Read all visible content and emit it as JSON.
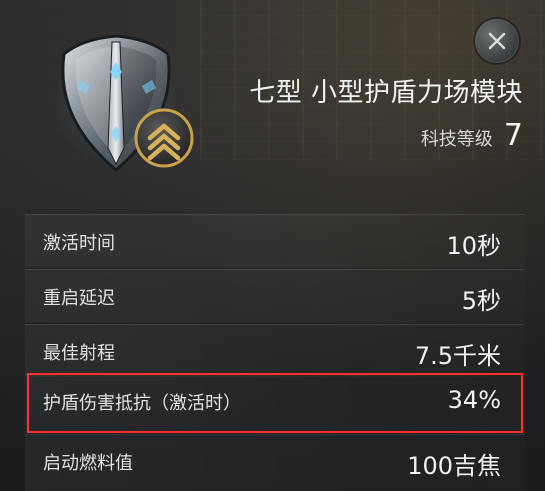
{
  "module": {
    "title": "七型 小型护盾力场模块",
    "tech_level_label": "科技等级",
    "tech_level_value": "7"
  },
  "icons": {
    "close": "close-icon",
    "shield": "shield-icon",
    "rank": "rank-chevrons-icon"
  },
  "stats": [
    {
      "label": "激活时间",
      "value": "10秒"
    },
    {
      "label": "重启延迟",
      "value": "5秒"
    },
    {
      "label": "最佳射程",
      "value": "7.5千米"
    },
    {
      "label": "护盾伤害抵抗（激活时）",
      "value": "34%"
    },
    {
      "label": "启动燃料值",
      "value": "100吉焦"
    }
  ],
  "colors": {
    "highlight": "#ff2f2f",
    "text": "#e6e6e6",
    "accent_gold": "#c9a24a"
  }
}
